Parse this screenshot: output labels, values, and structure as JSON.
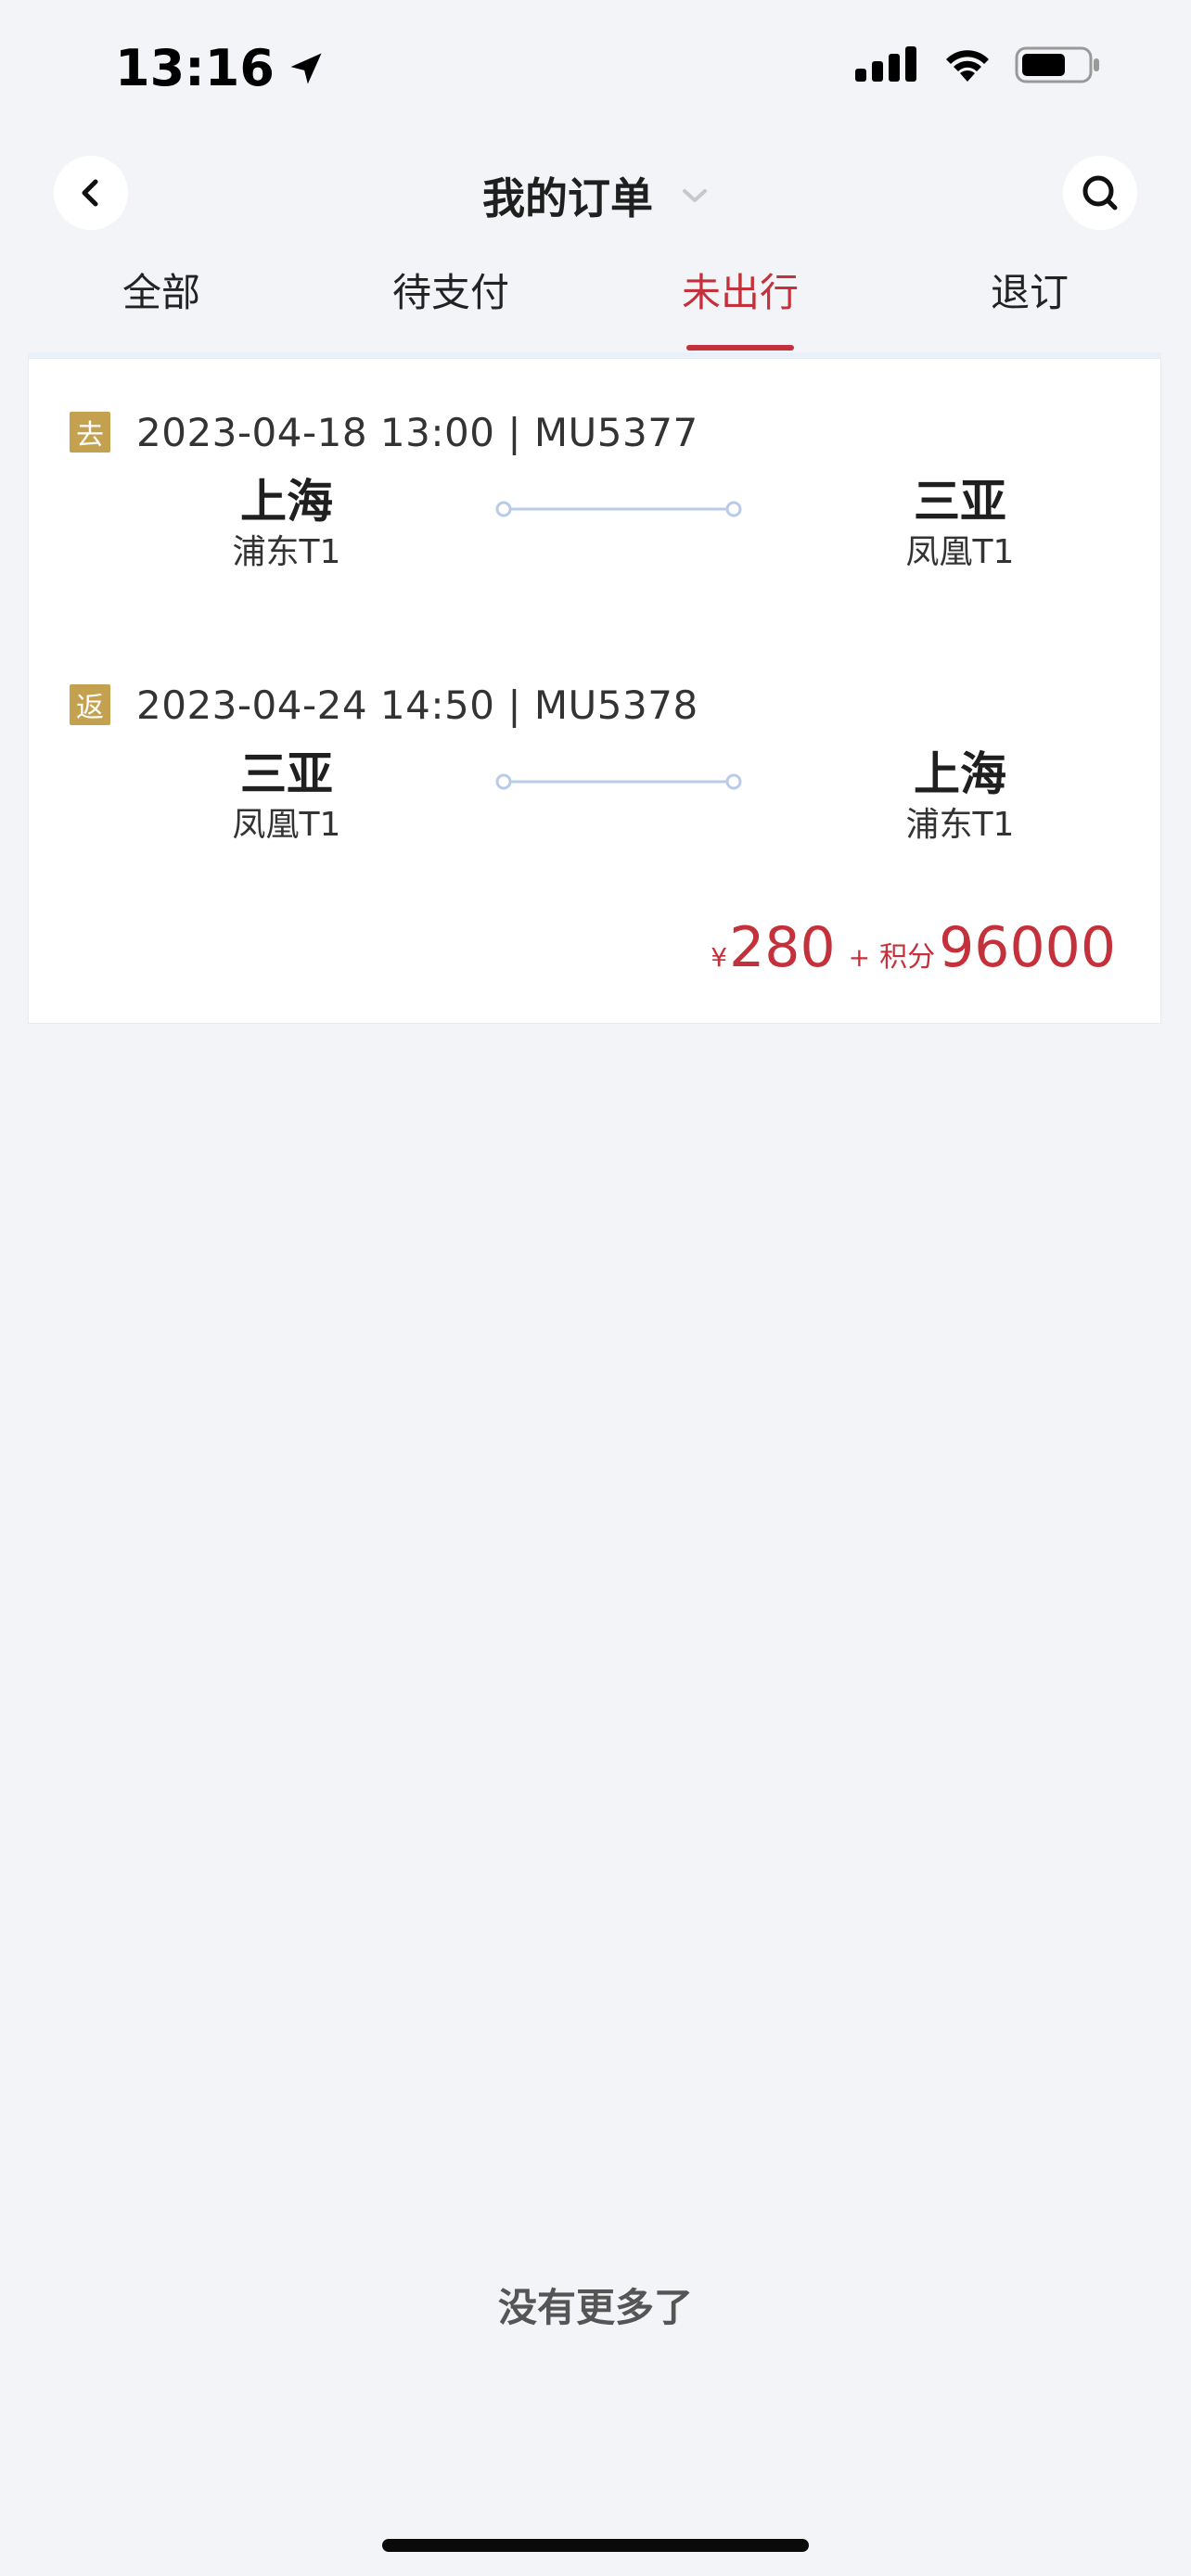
{
  "status_bar": {
    "time": "13:16"
  },
  "header": {
    "title": "我的订单"
  },
  "tabs": [
    {
      "label": "全部",
      "active": false
    },
    {
      "label": "待支付",
      "active": false
    },
    {
      "label": "未出行",
      "active": true
    },
    {
      "label": "退订",
      "active": false
    }
  ],
  "order": {
    "segments": [
      {
        "tag": "去",
        "info": "2023-04-18 13:00 | MU5377",
        "from_city": "上海",
        "from_terminal": "浦东T1",
        "to_city": "三亚",
        "to_terminal": "凤凰T1"
      },
      {
        "tag": "返",
        "info": "2023-04-24 14:50 | MU5378",
        "from_city": "三亚",
        "from_terminal": "凤凰T1",
        "to_city": "上海",
        "to_terminal": "浦东T1"
      }
    ],
    "price": {
      "currency": "¥",
      "amount": "280",
      "plus": "+",
      "points_label": "积分",
      "points": "96000"
    }
  },
  "footer": {
    "no_more": "没有更多了"
  },
  "colors": {
    "accent": "#c4313b",
    "tag_gold": "#c3a14f",
    "background": "#f2f4f8"
  }
}
